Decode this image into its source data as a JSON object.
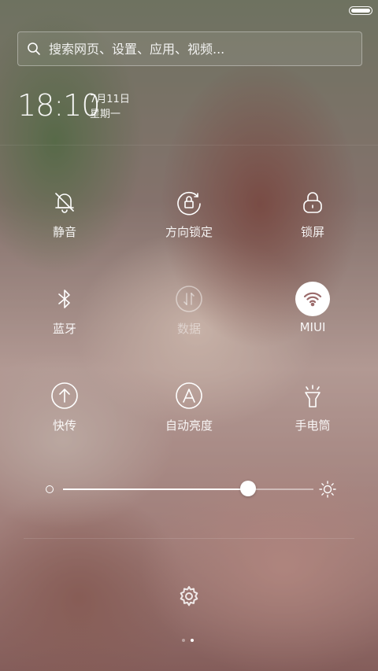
{
  "search": {
    "placeholder": "搜索网页、设置、应用、视频..."
  },
  "clock": {
    "time": "18:10",
    "date": "7月11日",
    "weekday": "星期一"
  },
  "toggles": [
    {
      "label": "静音",
      "icon": "bell-muted-icon",
      "state": "off"
    },
    {
      "label": "方向锁定",
      "icon": "rotation-lock-icon",
      "state": "off"
    },
    {
      "label": "锁屏",
      "icon": "lock-icon",
      "state": "off"
    },
    {
      "label": "蓝牙",
      "icon": "bluetooth-icon",
      "state": "off"
    },
    {
      "label": "数据",
      "icon": "mobile-data-icon",
      "state": "disabled"
    },
    {
      "label": "MIUI",
      "icon": "wifi-icon",
      "state": "on"
    },
    {
      "label": "快传",
      "icon": "mi-drop-icon",
      "state": "off"
    },
    {
      "label": "自动亮度",
      "icon": "auto-brightness-icon",
      "state": "off"
    },
    {
      "label": "手电筒",
      "icon": "flashlight-icon",
      "state": "off"
    }
  ],
  "brightness": {
    "level": 0.74
  },
  "pager": {
    "pages": 2,
    "current": 2
  },
  "colors": {
    "active_toggle_bg": "#ffffff",
    "active_icon": "#9b6b6b"
  }
}
